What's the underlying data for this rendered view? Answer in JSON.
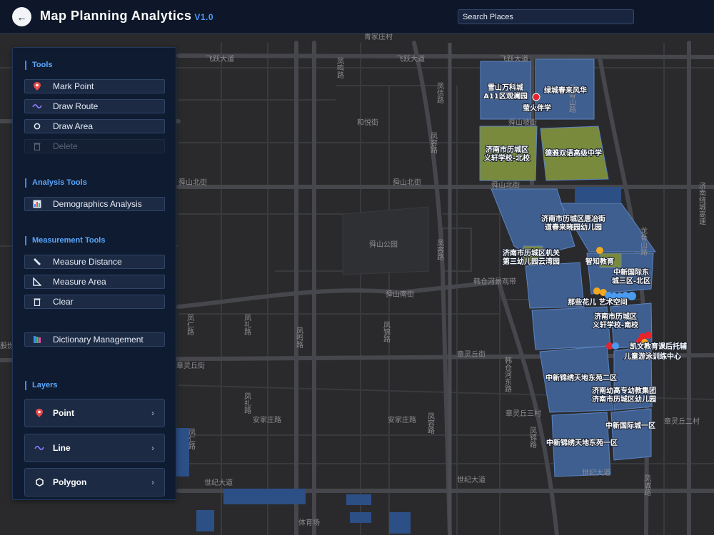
{
  "header": {
    "title": "Map Planning Analytics",
    "version": "V1.0",
    "back_icon": "arrow-left-icon",
    "search_placeholder": "Search Places"
  },
  "panel": {
    "tools": {
      "title": "Tools",
      "items": [
        {
          "label": "Mark Point",
          "icon": "pin-icon",
          "disabled": false
        },
        {
          "label": "Draw Route",
          "icon": "route-icon",
          "disabled": false
        },
        {
          "label": "Draw Area",
          "icon": "circle-icon",
          "disabled": false
        },
        {
          "label": "Delete",
          "icon": "trash-icon",
          "disabled": true
        }
      ]
    },
    "analysis": {
      "title": "Analysis Tools",
      "items": [
        {
          "label": "Demographics Analysis",
          "icon": "chart-icon"
        }
      ]
    },
    "measurement": {
      "title": "Measurement Tools",
      "items": [
        {
          "label": "Measure Distance",
          "icon": "ruler-icon"
        },
        {
          "label": "Measure Area",
          "icon": "triangle-ruler-icon"
        },
        {
          "label": "Clear",
          "icon": "trash-icon"
        }
      ]
    },
    "dictionary": {
      "label": "Dictionary Management",
      "icon": "books-icon"
    },
    "layers": {
      "title": "Layers",
      "items": [
        {
          "label": "Point",
          "icon": "pin-icon"
        },
        {
          "label": "Line",
          "icon": "line-icon"
        },
        {
          "label": "Polygon",
          "icon": "hexagon-icon"
        }
      ]
    }
  },
  "map": {
    "road_labels": [
      "青家庄村",
      "飞跃大道",
      "飞跃大道",
      "飞跃大道",
      "凤鸣路",
      "凤信路",
      "凤容路",
      "和悦街",
      "舜山坡街",
      "舜山北街",
      "舜山北街",
      "舜山北街",
      "舜山公园",
      "凤容路",
      "舜山南街",
      "韩仓河景观带",
      "龙骨山路",
      "龙骨山路",
      "济南绕城高速",
      "凤仁路",
      "凤礼路",
      "凤鸣路",
      "凤锦路",
      "章灵丘街",
      "章灵丘街",
      "韩仓河东路",
      "凤礼路",
      "安家庄路",
      "安家庄路",
      "凤容路",
      "章灵丘三村",
      "凤锦路",
      "章灵丘二村",
      "凤仁路",
      "世纪大道",
      "世纪大道",
      "世纪大道",
      "凤诚路",
      "体育场",
      "股份"
    ],
    "poi_labels": [
      "雪山万科城",
      "A11区观澜园",
      "绿城春来风华",
      "萤火伴学",
      "济南市历城区",
      "义轩学校-北校",
      "德雅双语高级中学",
      "济南市历城区唐冶街",
      "道春来晓园幼儿园",
      "济南市历城区机关",
      "第三幼儿园云湾园",
      "智知教育",
      "中新国际东",
      "城三区-北区",
      "那些花儿 艺术空间",
      "济南市历城区",
      "义轩学校-南校",
      "凯文教育课后托辅",
      "儿童游泳训练中心",
      "中新锦绣天地东苑二区",
      "济南幼高专幼教集团",
      "济南市历城区幼儿园",
      "中新国际城一区",
      "中新锦绣天地东苑一区"
    ]
  }
}
